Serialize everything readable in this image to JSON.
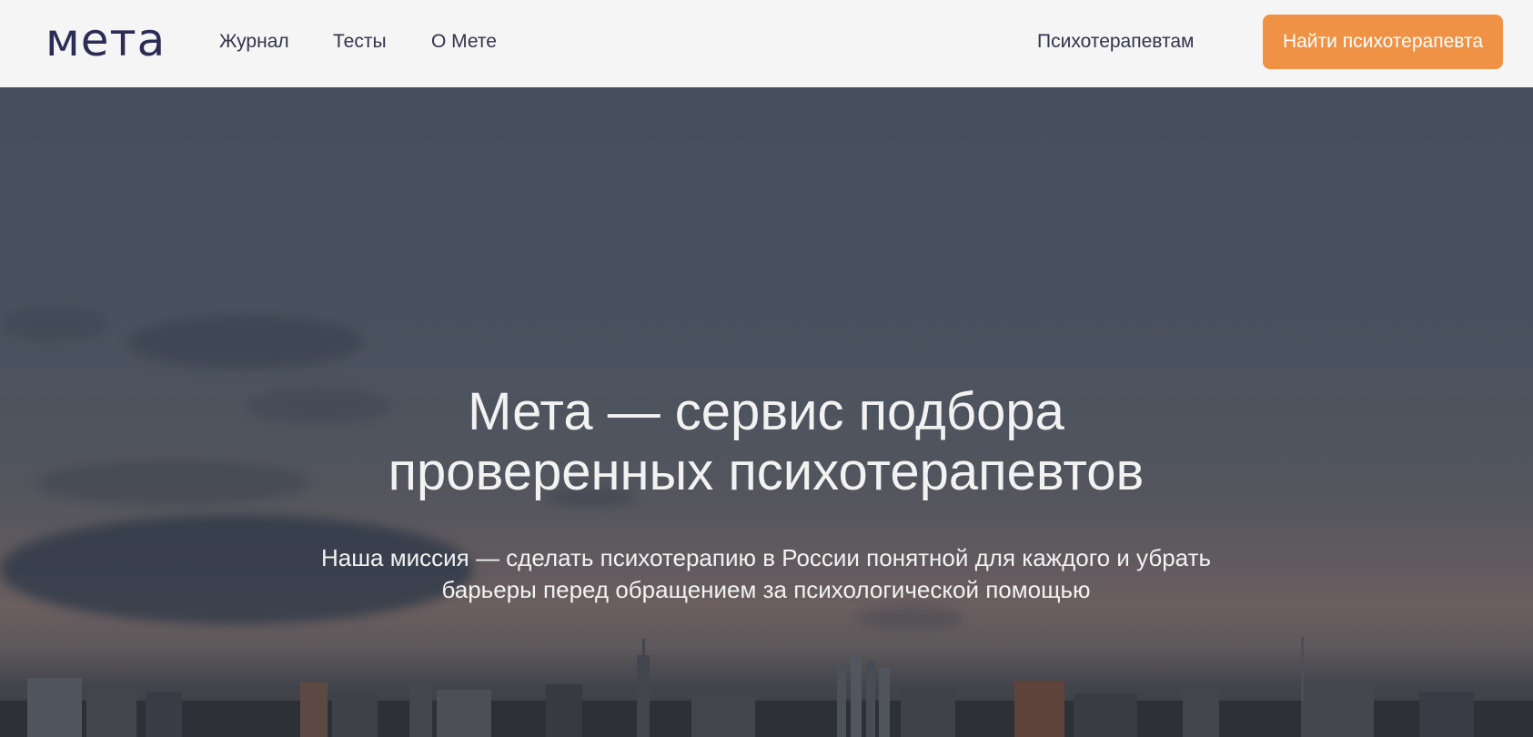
{
  "header": {
    "logo": "мета",
    "nav": [
      {
        "label": "Журнал"
      },
      {
        "label": "Тесты"
      },
      {
        "label": "О Мете"
      }
    ],
    "therapists_link": "Психотерапевтам",
    "cta_label": "Найти психотерапевта"
  },
  "hero": {
    "title_line1": "Мета — сервис подбора",
    "title_line2": "проверенных психотерапевтов",
    "subtitle_line1": "Наша миссия — сделать психотерапию в России понятной для каждого и убрать",
    "subtitle_line2": "барьеры перед обращением за психологической помощью"
  },
  "colors": {
    "accent": "#ef9245",
    "brand": "#2d2c55",
    "header_bg": "#f5f5f5"
  }
}
